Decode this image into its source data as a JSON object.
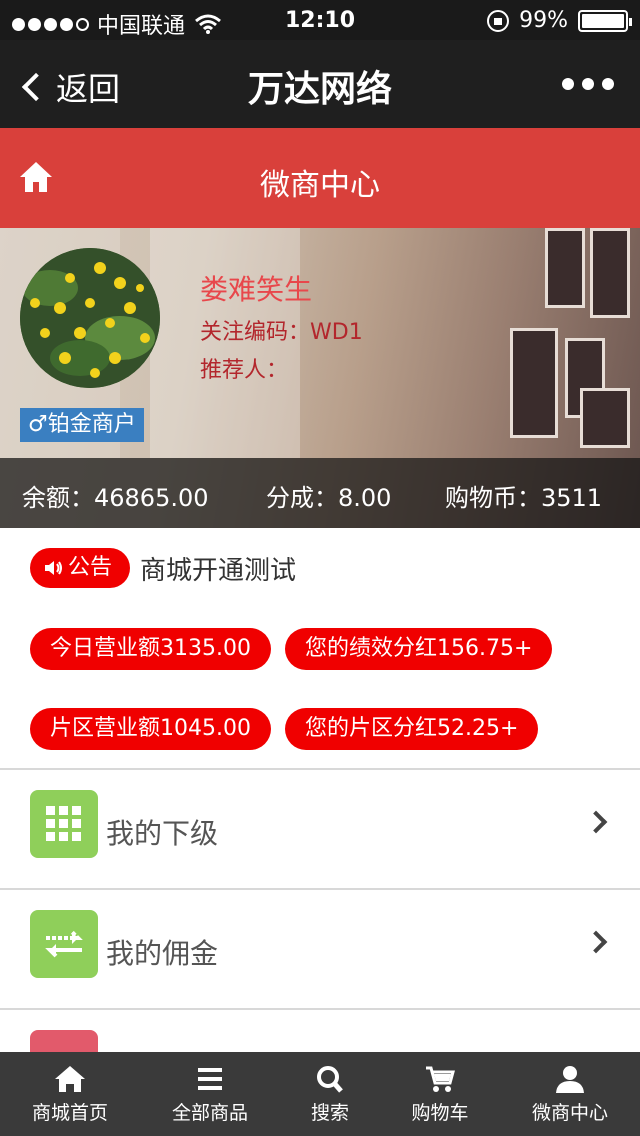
{
  "status_bar": {
    "carrier": "中国联通",
    "time": "12:10",
    "battery": "99%",
    "battery_level": 0.99
  },
  "nav": {
    "back_label": "返回",
    "title": "万达网络"
  },
  "header": {
    "title": "微商中心"
  },
  "profile": {
    "name": "娄难笑生",
    "follow_code": "关注编码：WD1",
    "referrer": "推荐人：",
    "level": "♂铂金商户",
    "balance": "余额：46865.00",
    "share": "分成：8.00",
    "coins": "购物币：3511"
  },
  "notice": {
    "badge": "公告",
    "text": "商城开通测试"
  },
  "stats": [
    "今日营业额3135.00",
    "您的绩效分红156.75+",
    "片区营业额1045.00",
    "您的片区分红52.25+"
  ],
  "menu": [
    {
      "label": "我的下级",
      "icon": "grid-icon"
    },
    {
      "label": "我的佣金",
      "icon": "transfer-icon"
    }
  ],
  "tabs": [
    {
      "label": "商城首页",
      "icon": "home-icon"
    },
    {
      "label": "全部商品",
      "icon": "menu-icon"
    },
    {
      "label": "搜索",
      "icon": "search-icon"
    },
    {
      "label": "购物车",
      "icon": "cart-icon"
    },
    {
      "label": "微商中心",
      "icon": "user-icon"
    }
  ],
  "colors": {
    "accent_red": "#d9403b",
    "pill_red": "#f00000",
    "icon_green": "#8fcf5a",
    "badge_blue": "#3a7fc1"
  }
}
